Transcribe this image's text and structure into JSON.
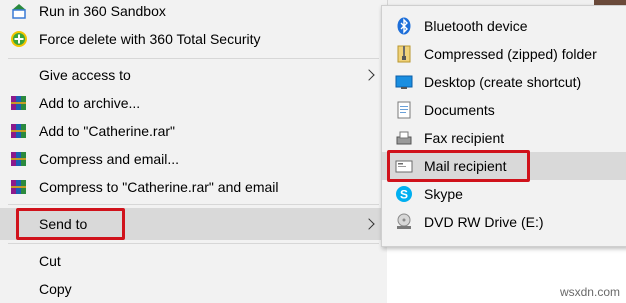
{
  "main_menu": {
    "items": [
      {
        "label": "Run in 360 Sandbox",
        "icon": "sandbox-icon"
      },
      {
        "label": "Force delete with 360 Total Security",
        "icon": "plus-shield-icon"
      },
      {
        "label": "Give access to",
        "icon": "none"
      },
      {
        "label": "Add to archive...",
        "icon": "winrar-icon"
      },
      {
        "label": "Add to \"Catherine.rar\"",
        "icon": "winrar-icon"
      },
      {
        "label": "Compress and email...",
        "icon": "winrar-icon"
      },
      {
        "label": "Compress to \"Catherine.rar\" and email",
        "icon": "winrar-icon"
      },
      {
        "label": "Send to",
        "icon": "none"
      },
      {
        "label": "Cut",
        "icon": "none"
      },
      {
        "label": "Copy",
        "icon": "none"
      }
    ]
  },
  "send_to_menu": {
    "items": [
      {
        "label": "Bluetooth device",
        "icon": "bluetooth-icon"
      },
      {
        "label": "Compressed (zipped) folder",
        "icon": "zip-folder-icon"
      },
      {
        "label": "Desktop (create shortcut)",
        "icon": "desktop-icon"
      },
      {
        "label": "Documents",
        "icon": "documents-icon"
      },
      {
        "label": "Fax recipient",
        "icon": "fax-icon"
      },
      {
        "label": "Mail recipient",
        "icon": "mail-icon"
      },
      {
        "label": "Skype",
        "icon": "skype-icon"
      },
      {
        "label": "DVD RW Drive (E:)",
        "icon": "dvd-drive-icon"
      }
    ]
  },
  "highlight_color": "#d0121b",
  "watermark": "wsxdn.com"
}
